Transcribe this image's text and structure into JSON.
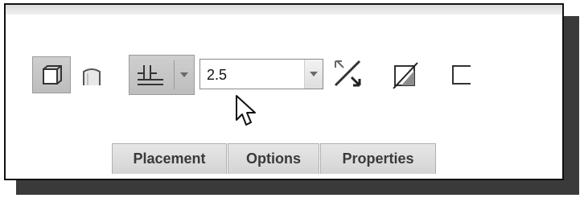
{
  "depth": {
    "value": "2.5"
  },
  "tabs": [
    {
      "label": "Placement"
    },
    {
      "label": "Options"
    },
    {
      "label": "Properties"
    }
  ],
  "icons": {
    "solid": "solid-icon",
    "surface": "surface-icon",
    "depth_option": "blind-depth-icon",
    "flip_direction": "flip-direction-icon",
    "remove_material": "remove-material-icon",
    "thicken": "thicken-sketch-icon"
  },
  "colors": {
    "panel_border": "#111111",
    "shadow": "#3a3a3a",
    "tab_bg": "#dcdcdc",
    "pressed_button_bg": "#c6c6c6"
  }
}
